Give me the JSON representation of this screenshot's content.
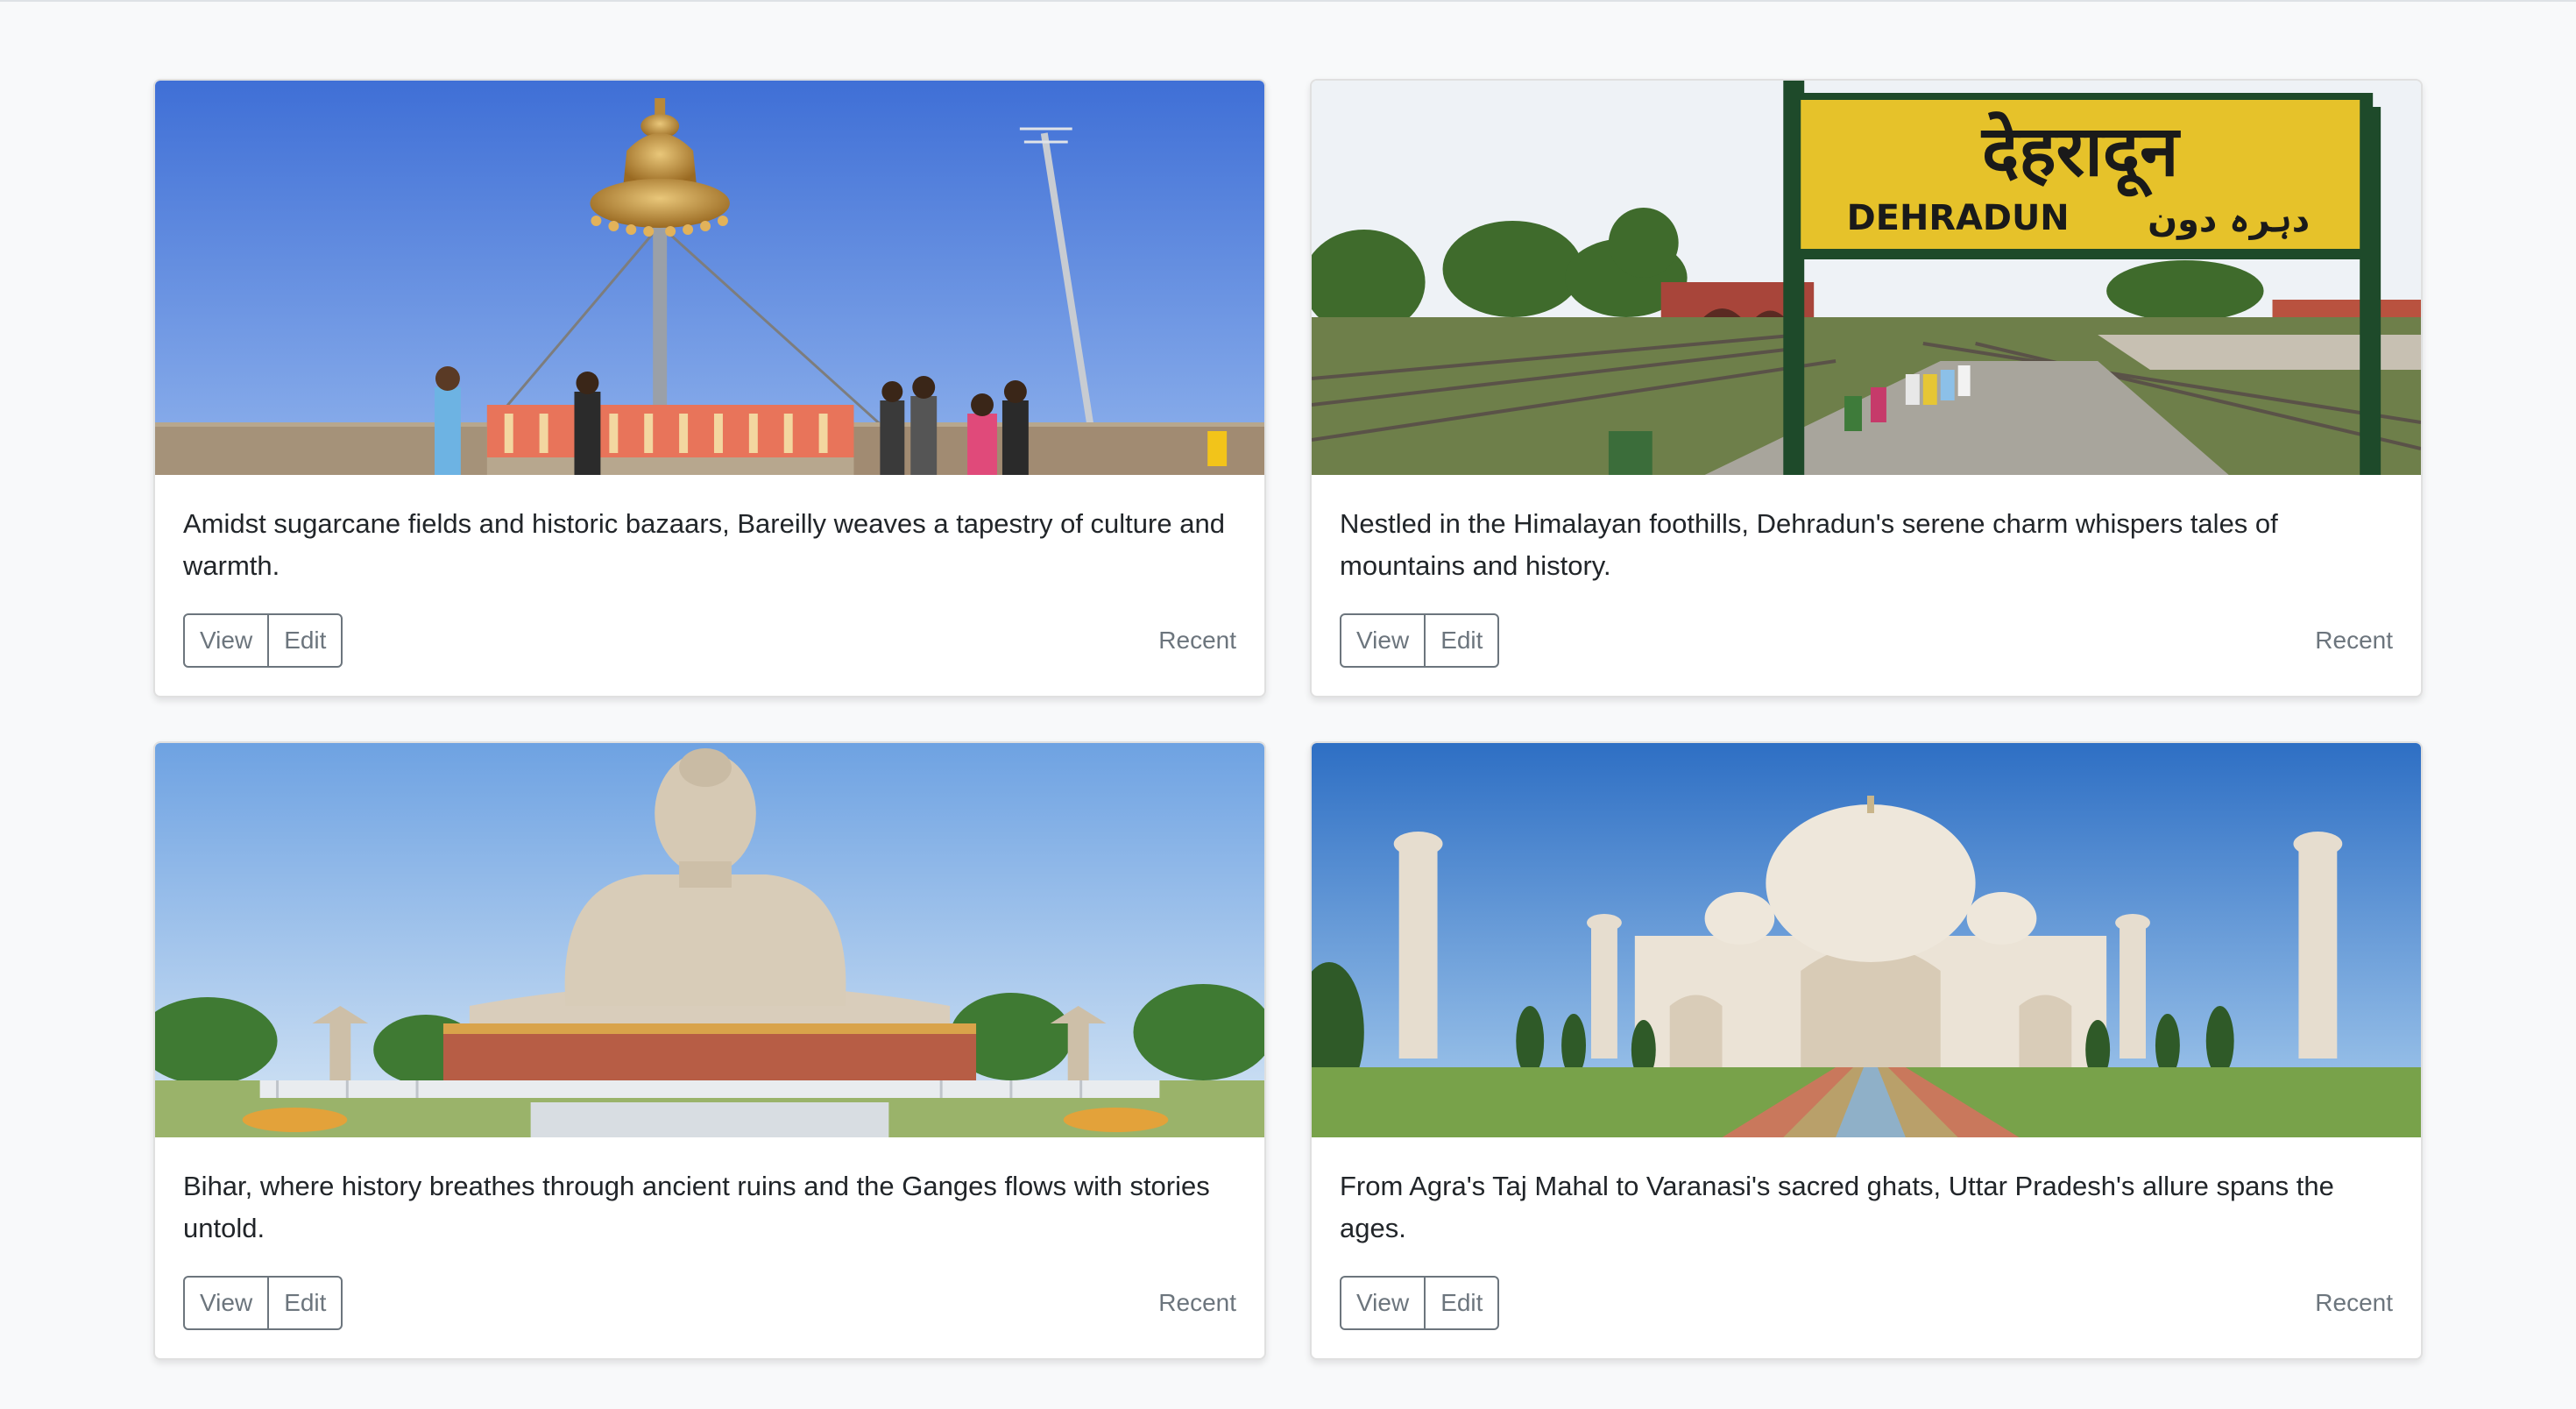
{
  "cards": [
    {
      "image_alt": "Bareilly monument with golden jhumka sculpture",
      "text": "Amidst sugarcane fields and historic bazaars, Bareilly weaves a tapestry of culture and warmth.",
      "view_label": "View",
      "edit_label": "Edit",
      "meta": "Recent"
    },
    {
      "image_alt": "Dehradun railway station sign",
      "sign_hindi": "देहरादून",
      "sign_english": "DEHRADUN",
      "sign_urdu": "دہرہ دون",
      "text": "Nestled in the Himalayan foothills, Dehradun's serene charm whispers tales of mountains and history.",
      "view_label": "View",
      "edit_label": "Edit",
      "meta": "Recent"
    },
    {
      "image_alt": "Great Buddha statue, Bodh Gaya",
      "text": "Bihar, where history breathes through ancient ruins and the Ganges flows with stories untold.",
      "view_label": "View",
      "edit_label": "Edit",
      "meta": "Recent"
    },
    {
      "image_alt": "Taj Mahal, Agra",
      "text": "From Agra's Taj Mahal to Varanasi's sacred ghats, Uttar Pradesh's allure spans the ages.",
      "view_label": "View",
      "edit_label": "Edit",
      "meta": "Recent"
    }
  ]
}
